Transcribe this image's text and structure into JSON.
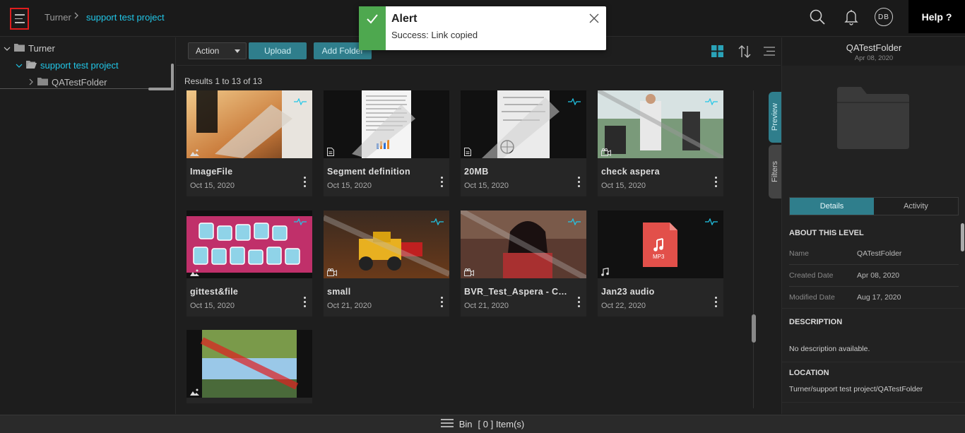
{
  "header": {
    "breadcrumb": [
      "Turner",
      "support test project"
    ],
    "breadcrumb_sep": ">",
    "avatar_initials": "DB",
    "help_label": "Help ?"
  },
  "alert": {
    "title": "Alert",
    "message": "Success: Link copied"
  },
  "tree": [
    {
      "label": "Turner",
      "level": 0
    },
    {
      "label": "support test project",
      "level": 1
    },
    {
      "label": "QATestFolder",
      "level": 2
    }
  ],
  "toolbar": {
    "action_label": "Action",
    "upload_label": "Upload",
    "add_folder_label": "Add Folder"
  },
  "results_text": "Results 1 to 13 of 13",
  "assets": [
    {
      "name": "ImageFile",
      "date": "Oct 15, 2020",
      "type_icon": "image-icon"
    },
    {
      "name": "Segment definition",
      "date": "Oct 15, 2020",
      "type_icon": "document-icon"
    },
    {
      "name": "20MB",
      "date": "Oct 15, 2020",
      "type_icon": "document-icon"
    },
    {
      "name": "check aspera",
      "date": "Oct 15, 2020",
      "type_icon": "video-icon"
    },
    {
      "name": "gittest&file",
      "date": "Oct 15, 2020",
      "type_icon": "image-icon"
    },
    {
      "name": "small",
      "date": "Oct 21, 2020",
      "type_icon": "video-icon"
    },
    {
      "name": "BVR_Test_Aspera - Copy...",
      "date": "Oct 21, 2020",
      "type_icon": "video-icon"
    },
    {
      "name": "Jan23 audio",
      "date": "Oct 22, 2020",
      "type_icon": "audio-icon"
    },
    {
      "name": "",
      "date": "",
      "type_icon": "image-icon"
    }
  ],
  "side_tabs": {
    "preview": "Preview",
    "filters": "Filters"
  },
  "details": {
    "title": "QATestFolder",
    "date": "Apr 08, 2020",
    "tabs": [
      "Details",
      "Activity"
    ],
    "about_heading": "ABOUT THIS LEVEL",
    "fields": [
      {
        "label": "Name",
        "value": "QATestFolder"
      },
      {
        "label": "Created Date",
        "value": "Apr 08, 2020"
      },
      {
        "label": "Modified Date",
        "value": "Aug 17, 2020"
      }
    ],
    "description_heading": "DESCRIPTION",
    "description": "No description available.",
    "location_heading": "LOCATION",
    "location": "Turner/support test project/QATestFolder"
  },
  "bin": {
    "label": "Bin",
    "count_text": "[ 0 ] Item(s)"
  },
  "mp3_badge": "MP3",
  "colors": {
    "accent": "#21c7e8",
    "teal": "#2f7e8c",
    "success": "#4ea84f",
    "hamburger_highlight": "#e01e1e"
  }
}
